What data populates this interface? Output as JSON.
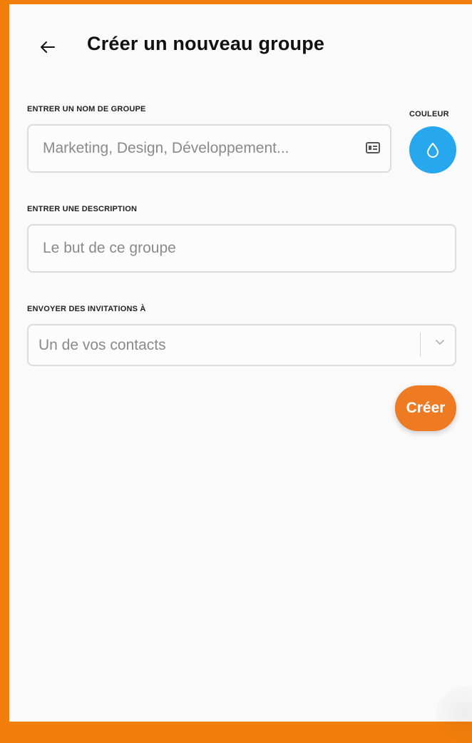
{
  "header": {
    "title": "Créer un nouveau groupe",
    "back_icon": "arrow-left-icon"
  },
  "form": {
    "group_name": {
      "label": "ENTRER UN NOM DE GROUPE",
      "placeholder": "Marketing, Design, Développement...",
      "value": "",
      "icon": "contact-card-icon"
    },
    "color": {
      "label": "COULEUR",
      "value": "#27a8ee",
      "icon": "droplet-icon"
    },
    "description": {
      "label": "ENTRER UNE DESCRIPTION",
      "placeholder": "Le but de ce groupe",
      "value": ""
    },
    "invitations": {
      "label": "ENVOYER DES INVITATIONS À",
      "placeholder": "Un de vos contacts",
      "icon": "chevron-down-icon"
    },
    "submit_label": "Créer"
  },
  "colors": {
    "frame": "#f27f0b",
    "background": "#fafafa",
    "accent": "#ee7a22",
    "color_swatch": "#27a8ee",
    "border": "#dcdcdc"
  }
}
